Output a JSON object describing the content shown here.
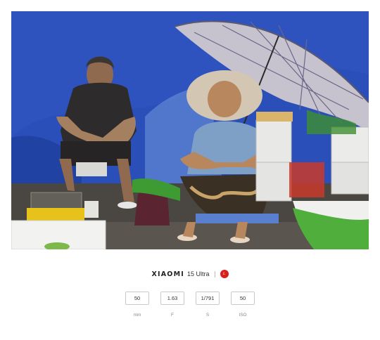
{
  "photo": {
    "description_icon": "street-market-photo"
  },
  "watermark": {
    "brand": "XIAOMI",
    "model": "15 Ultra",
    "lens_brand_icon": "leica-logo",
    "lens_brand_color": "#d8201c"
  },
  "exif": [
    {
      "value": "50",
      "unit": "mm"
    },
    {
      "value": "1.63",
      "unit": "F"
    },
    {
      "value": "1/791",
      "unit": "S"
    },
    {
      "value": "50",
      "unit": "ISO"
    }
  ]
}
